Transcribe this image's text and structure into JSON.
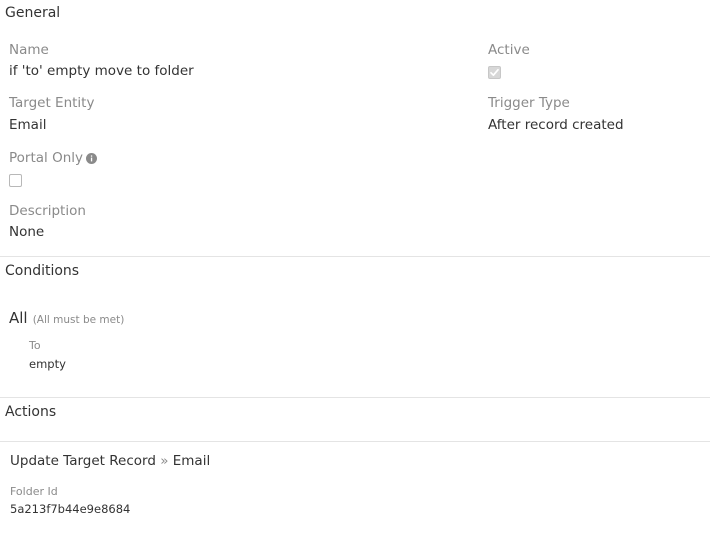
{
  "general": {
    "title": "General",
    "name_label": "Name",
    "name_value": "if 'to' empty move to folder",
    "active_label": "Active",
    "active_checked": true,
    "target_entity_label": "Target Entity",
    "target_entity_value": "Email",
    "trigger_type_label": "Trigger Type",
    "trigger_type_value": "After record created",
    "portal_only_label": "Portal Only",
    "portal_only_checked": false,
    "description_label": "Description",
    "description_value": "None"
  },
  "conditions": {
    "title": "Conditions",
    "group_label": "All",
    "group_hint": "(All must be met)",
    "items": [
      {
        "field": "To",
        "value": "empty"
      }
    ]
  },
  "actions": {
    "title": "Actions",
    "items": [
      {
        "type": "Update Target Record",
        "separator": "»",
        "entity": "Email",
        "field_label": "Folder Id",
        "field_value": "5a213f7b44e9e8684"
      }
    ]
  },
  "icons": {
    "info": "info-icon",
    "checkmark": "checkmark-icon"
  }
}
